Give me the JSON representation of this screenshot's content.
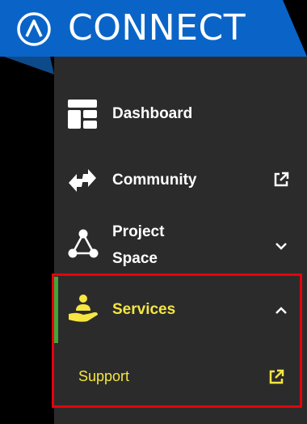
{
  "header": {
    "brand": "CONNECT",
    "logo_icon": "lambda-circle-logo-icon",
    "bg_color": "#0a64c8",
    "accent_color": "#0d4a8a"
  },
  "nav": {
    "items": [
      {
        "label": "Dashboard",
        "icon": "dashboard-grid-icon",
        "trail_icon": ""
      },
      {
        "label": "Community",
        "icon": "exchange-arrows-icon",
        "trail_icon": "external-link-icon"
      },
      {
        "label_line1": "Project",
        "label_line2": "Space",
        "icon": "network-triangle-icon",
        "trail_icon": "chevron-down-icon"
      },
      {
        "label": "Services",
        "icon": "hand-service-icon",
        "trail_icon": "chevron-up-icon",
        "active": true
      }
    ],
    "sub_items": [
      {
        "label": "Support",
        "trail_icon": "external-link-icon"
      }
    ]
  },
  "colors": {
    "sidebar_bg": "#2b2b2b",
    "active_text": "#f5e642",
    "active_indicator": "#3ca83a",
    "highlight_border": "#e8000b"
  }
}
